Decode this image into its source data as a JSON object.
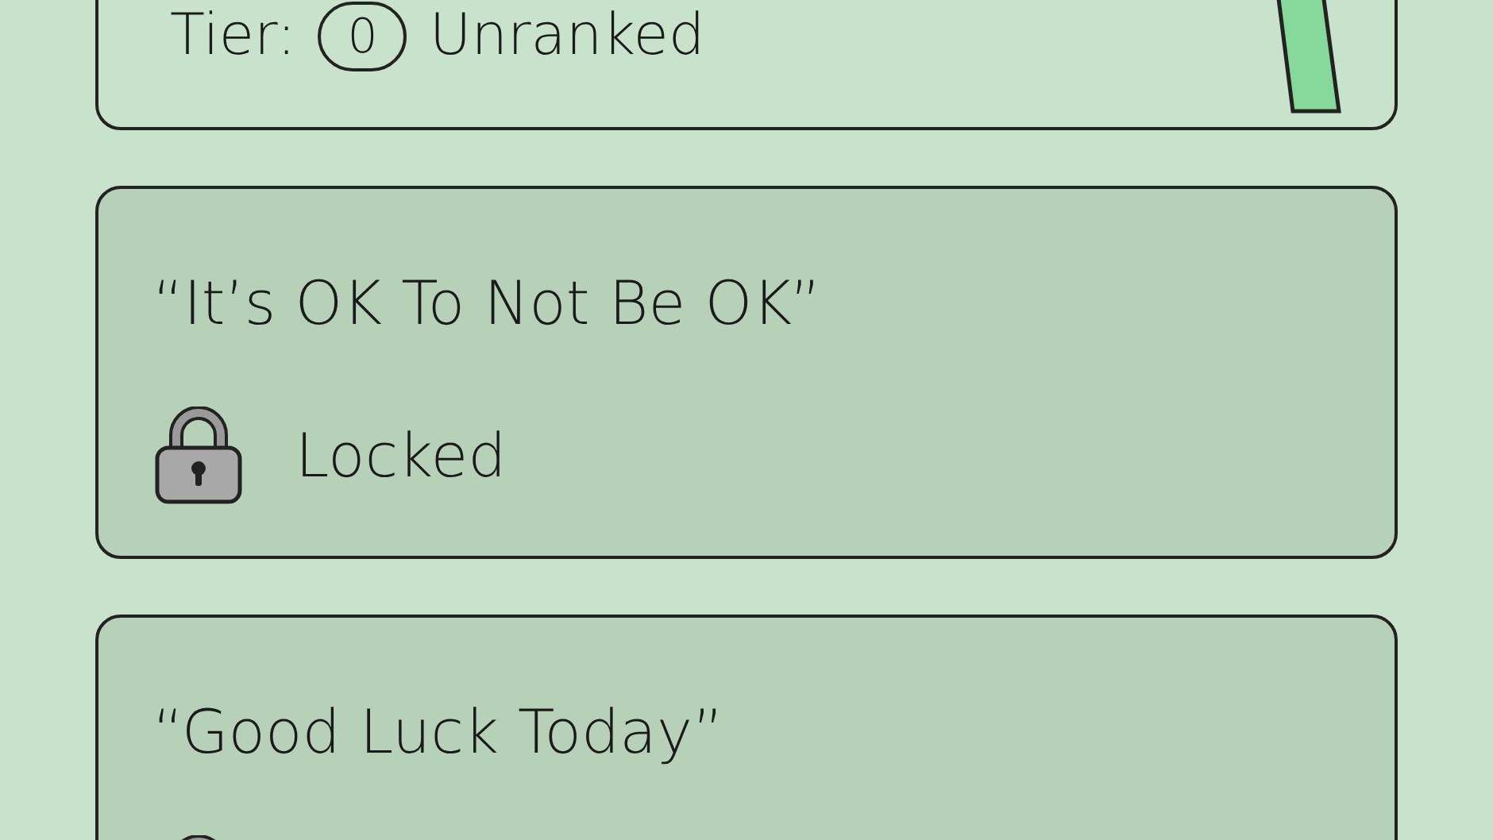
{
  "cards": [
    {
      "tier_label": "Tier:",
      "tier_badge": "0",
      "tier": "Unranked",
      "locked": false
    },
    {
      "title": "“It’s OK To Not Be OK”",
      "locked": true,
      "status": "Locked"
    },
    {
      "title": "“Good Luck Today”",
      "locked": true
    }
  ]
}
